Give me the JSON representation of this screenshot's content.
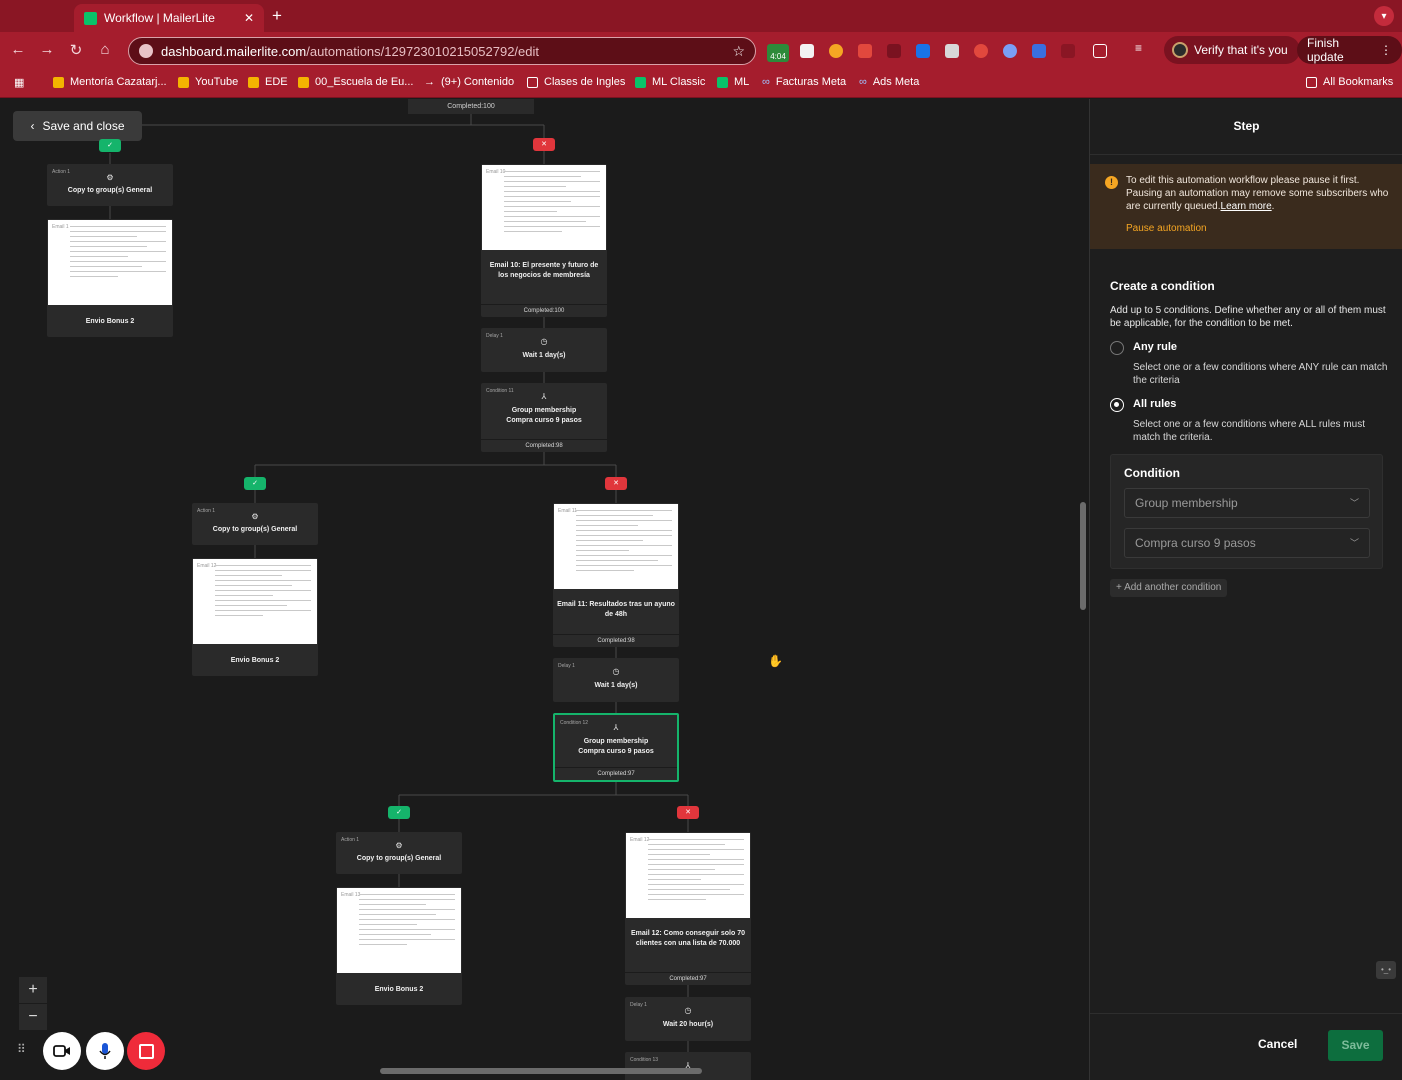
{
  "browser": {
    "tab_title": "Workflow | MailerLite",
    "url_host": "dashboard.mailerlite.com",
    "url_path": "/automations/129723010215052792/edit",
    "ext_badge": "4:04",
    "verify_label": "Verify that it's you",
    "finish_update_label": "Finish update",
    "bookmarks": [
      "Mentoría Cazatarj...",
      "YouTube",
      "EDE",
      "00_Escuela de Eu...",
      "(9+) Contenido",
      "Clases de Ingles",
      "ML Classic",
      "ML",
      "Facturas Meta",
      "Ads Meta",
      "All Bookmarks"
    ],
    "colors": {
      "chrome": "#a51d2d",
      "tabbar": "#8a1624"
    }
  },
  "canvas": {
    "save_close_label": "Save and close",
    "top_completed": "Completed:100",
    "nodes": {
      "a1_kind": "Action 1",
      "a1_label": "Copy to group(s) General",
      "e1_kind": "Email 1",
      "e1_label": "Envio Bonus 2",
      "e10_kind": "Email 10",
      "e10_label": "Email 10: El presente y futuro de los negocios de membresía",
      "e10_done": "Completed:100",
      "d1_kind": "Delay 1",
      "d1_label": "Wait 1 day(s)",
      "c11_kind": "Condition 11",
      "c11_label1": "Group membership",
      "c11_label2": "Compra curso 9 pasos",
      "c11_done": "Completed:98",
      "a2_kind": "Action 1",
      "a2_label": "Copy to group(s) General",
      "e2_kind": "Email 12",
      "e2_label": "Envio Bonus 2",
      "e11_kind": "Email 11",
      "e11_label": "Email 11: Resultados tras un ayuno de 48h",
      "e11_done": "Completed:98",
      "d2_kind": "Delay 1",
      "d2_label": "Wait 1 day(s)",
      "c12_kind": "Condition 12",
      "c12_label1": "Group membership",
      "c12_label2": "Compra curso 9 pasos",
      "c12_done": "Completed:97",
      "a3_kind": "Action 1",
      "a3_label": "Copy to group(s) General",
      "e3_kind": "Email 13",
      "e3_label": "Envio Bonus 2",
      "e12_kind": "Email 12",
      "e12_label": "Email 12: Como conseguir solo 70 clientes con una lista de 70.000",
      "e12_done": "Completed:97",
      "d3_kind": "Delay 1",
      "d3_label": "Wait 20 hour(s)",
      "c13_kind": "Condition 13"
    },
    "pill_yes": "✓",
    "pill_no": "✕",
    "zoom_in": "+",
    "zoom_out": "−"
  },
  "panel": {
    "title": "Step",
    "warning_text": "To edit this automation workflow please pause it first. Pausing an automation may remove some subscribers who are currently queued.",
    "warning_link": "Learn more",
    "warning_action": "Pause automation",
    "create_title": "Create a condition",
    "create_desc": "Add up to 5 conditions. Define whether any or all of them must be applicable, for the condition to be met.",
    "any_title": "Any rule",
    "any_desc": "Select one or a few conditions where ANY rule can match the criteria",
    "all_title": "All rules",
    "all_desc": "Select one or a few conditions where ALL rules must match the criteria.",
    "selected_rule": "all",
    "condition_title": "Condition",
    "condition_field": "Group membership",
    "condition_value": "Compra curso 9 pasos",
    "add_condition": "+ Add another condition",
    "cancel_label": "Cancel",
    "save_label": "Save",
    "colors": {
      "accent": "#15b46b",
      "warning": "#f5a623",
      "danger": "#e1363c"
    }
  }
}
